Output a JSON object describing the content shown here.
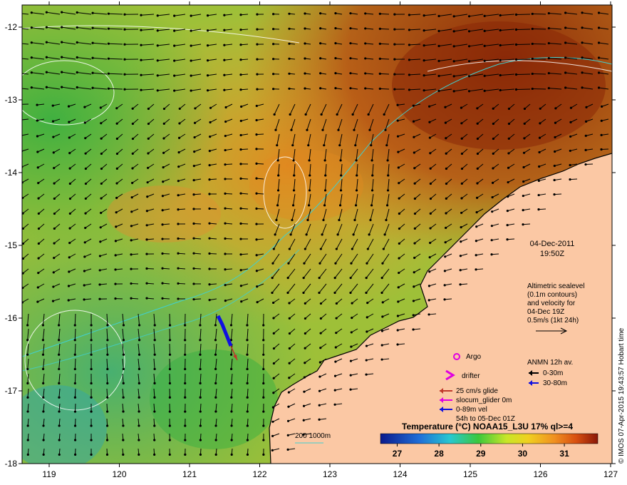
{
  "map": {
    "date": "04-Dec-2011",
    "time": "19:50Z",
    "sealevel_note": [
      "Altimetric sealevel",
      "(0.1m contours)",
      "and velocity for",
      "04-Dec 19Z",
      "0.5m/s (1kt 24h)"
    ],
    "lon_ticks": [
      "119",
      "120",
      "121",
      "122",
      "123",
      "124",
      "125",
      "126",
      "127"
    ],
    "lat_ticks": [
      "-12",
      "-13",
      "-14",
      "-15",
      "-16",
      "-17",
      "-18"
    ],
    "credit": "© IMOS 07-Apr-2015 19:43:57 Hobart time"
  },
  "legend": {
    "argo": "Argo",
    "drifter": "drifter",
    "anmn_title": "ANMN 12h av.",
    "anmn_items": [
      "0-30m",
      "30-80m"
    ],
    "glider_items": [
      "25 cm/s glide",
      "slocum_glider 0m",
      "0-89m vel",
      "54h to 05-Dec 01Z"
    ],
    "bathy": "200  1000m"
  },
  "colorbar": {
    "title": "Temperature (°C) NOAA15_L3U 17% ql>=4",
    "ticks": [
      "27",
      "28",
      "29",
      "30",
      "31"
    ],
    "range": [
      26.6,
      31.8
    ]
  },
  "colors": {
    "land": "#fbc8a4",
    "argo": "#e000e0",
    "drifter": "#e000e0",
    "glide": "#c0392b",
    "anmn_shallow": "#000000",
    "anmn_deep": "#1010e0",
    "bathy": "#40d0d0"
  }
}
